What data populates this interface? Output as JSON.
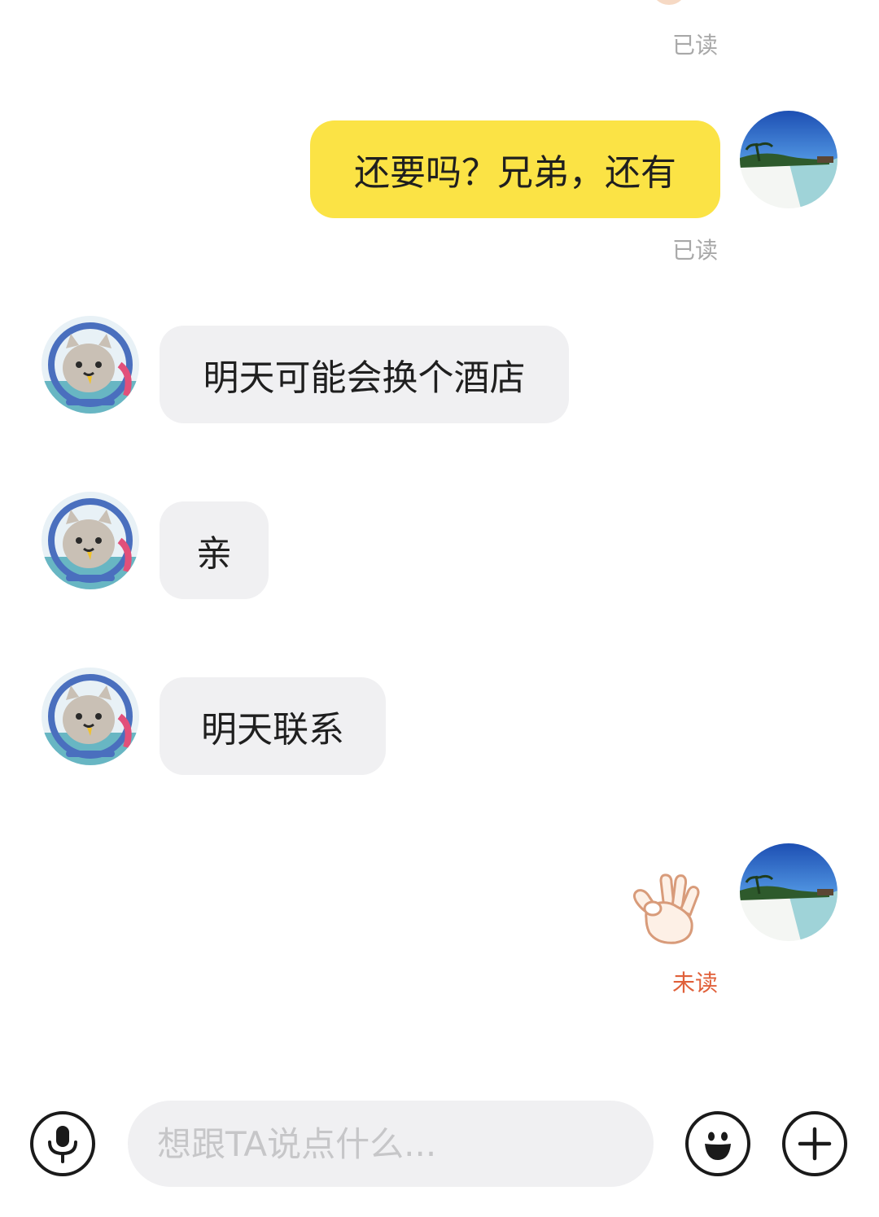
{
  "messages": [
    {
      "side": "out",
      "type": "status-only",
      "status": "已读"
    },
    {
      "side": "out",
      "type": "text",
      "text": "还要吗？兄弟，还有",
      "status": "已读"
    },
    {
      "side": "in",
      "type": "text",
      "text": "明天可能会换个酒店"
    },
    {
      "side": "in",
      "type": "text",
      "text": "亲"
    },
    {
      "side": "in",
      "type": "text",
      "text": "明天联系"
    },
    {
      "side": "out",
      "type": "emoji",
      "emoji": "ok-hand-emoji",
      "status": "未读"
    }
  ],
  "input_bar": {
    "placeholder": "想跟TA说点什么...",
    "voice_icon": "microphone-icon",
    "emoji_icon": "smiley-face-icon",
    "plus_icon": "plus-icon"
  },
  "colors": {
    "outgoing_bubble": "#fbe345",
    "incoming_bubble": "#f0f0f2",
    "read_status": "#a8a8a8",
    "unread_status": "#e0603a"
  }
}
